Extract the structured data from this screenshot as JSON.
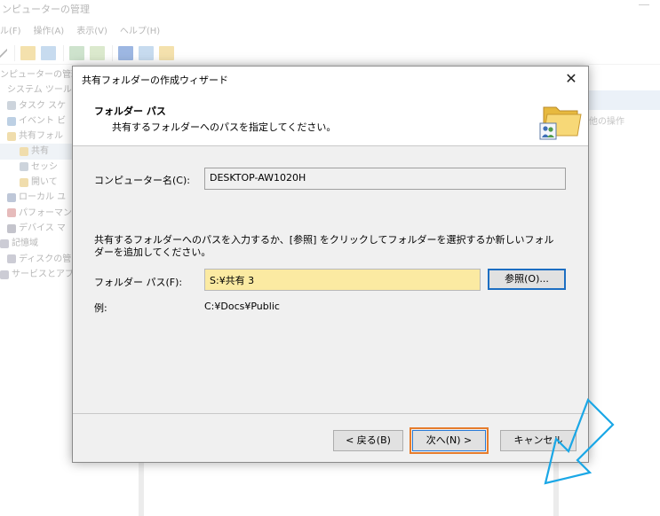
{
  "background": {
    "window_title": "ンピューターの管理",
    "menu": [
      "ル(F)",
      "操作(A)",
      "表示(V)",
      "ヘルプ(H)"
    ],
    "tree": [
      "ンピューターの管理",
      "システム ツール",
      "タスク スケ",
      "イベント ビ",
      "共有フォル",
      "共有",
      "セッシ",
      "開いて",
      "ローカル ユ",
      "パフォーマン",
      "デバイス マ",
      "記憶域",
      "ディスクの管",
      "サービスとアプ"
    ],
    "right_panel_text": "他の操作"
  },
  "dialog": {
    "title": "共有フォルダーの作成ウィザード",
    "header": {
      "title": "フォルダー パス",
      "subtitle": "共有するフォルダーへのパスを指定してください。"
    },
    "computer_name_label": "コンピューター名(C):",
    "computer_name_value": "DESKTOP-AW1020H",
    "instruction": "共有するフォルダーへのパスを入力するか、[参照] をクリックしてフォルダーを選択するか新しいフォルダーを追加してください。",
    "folder_path_label": "フォルダー パス(F):",
    "folder_path_value": "S:¥共有 3",
    "browse_label": "参照(O)...",
    "example_label": "例:",
    "example_value": "C:¥Docs¥Public",
    "back_label": "< 戻る(B)",
    "next_label": "次へ(N) >",
    "cancel_label": "キャンセル"
  },
  "colors": {
    "highlight": "#e67c2c",
    "arrow": "#1aa7e6",
    "path_field": "#fbeaa2"
  }
}
